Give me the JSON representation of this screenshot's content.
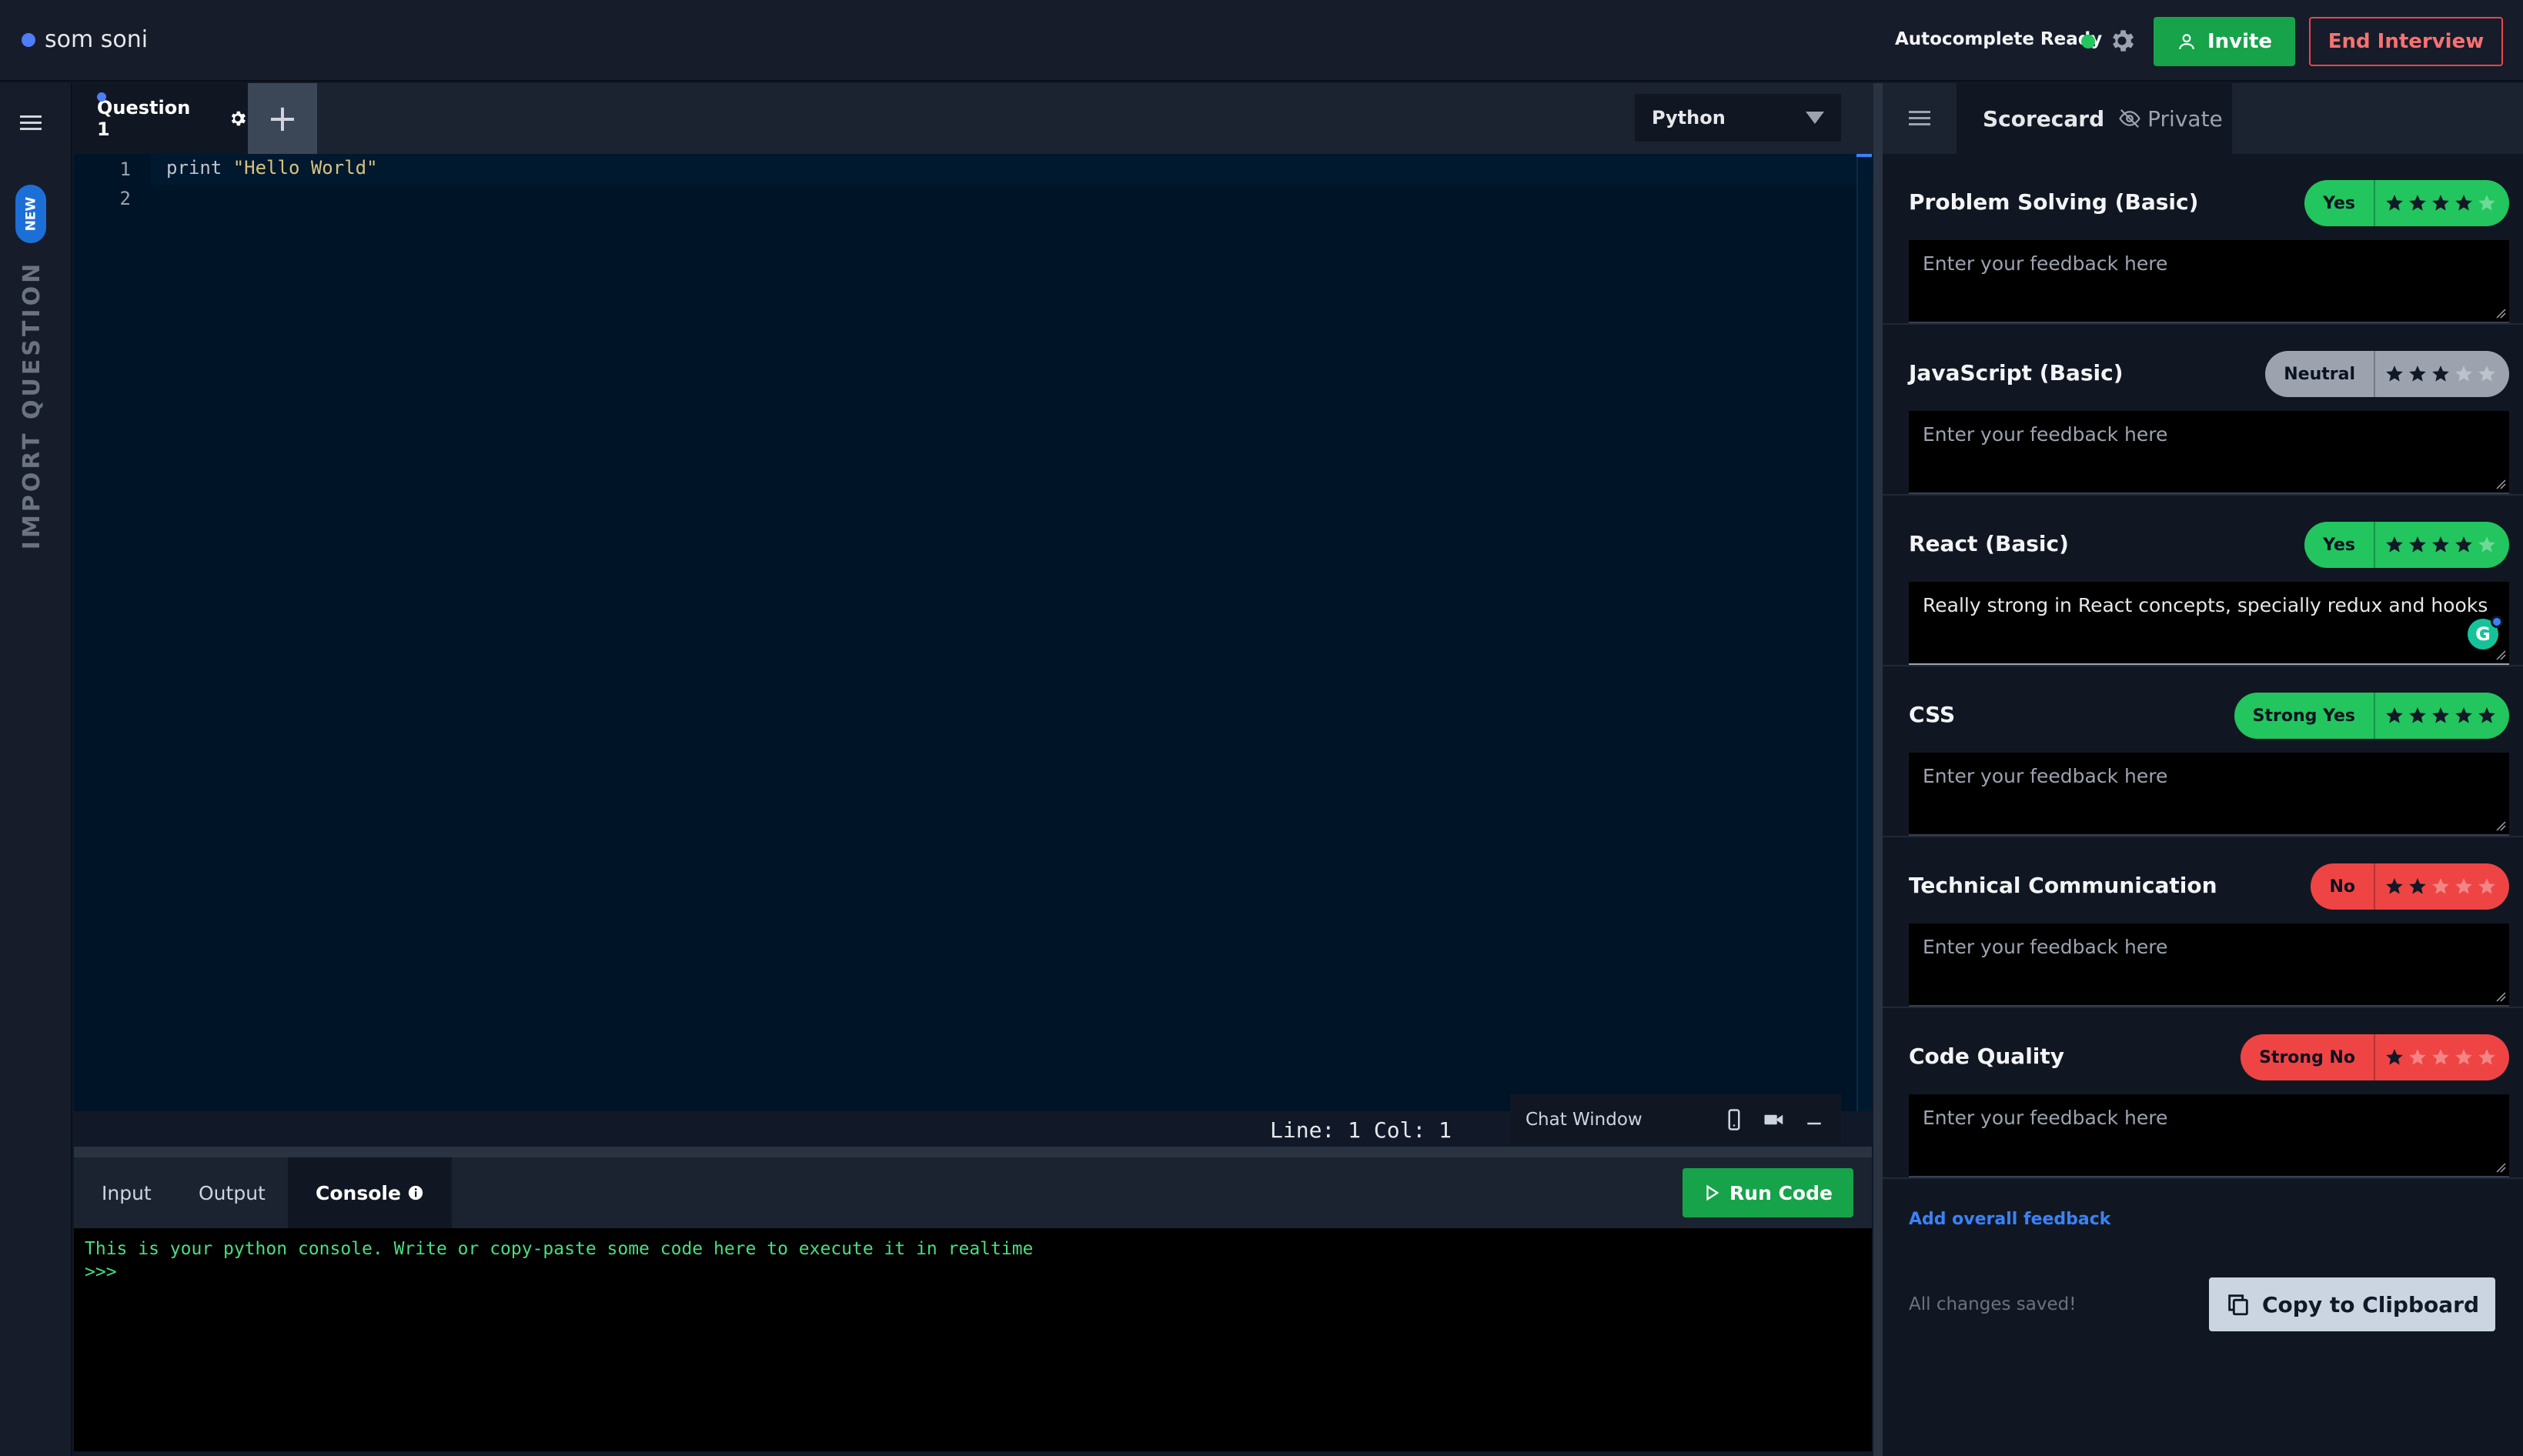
{
  "header": {
    "user_name": "som soni",
    "autocomplete_status": "Autocomplete Ready",
    "invite_label": "Invite",
    "end_interview_label": "End Interview"
  },
  "sidebar": {
    "new_badge": "NEW",
    "import_label": "IMPORT QUESTION"
  },
  "editor": {
    "tab_label": "Question 1",
    "add_tab_symbol": "+",
    "language": "Python",
    "line_numbers": [
      "1",
      "2"
    ],
    "code_keyword": "print",
    "code_string": "\"Hello World\"",
    "cursor_status": "Line: 1 Col: 1"
  },
  "chat": {
    "title": "Chat Window"
  },
  "bottom": {
    "tabs": [
      "Input",
      "Output",
      "Console"
    ],
    "active_tab": "Console",
    "run_label": "Run Code",
    "console_lines": [
      "This is your python console. Write or copy-paste some code here to execute it in realtime",
      ">>>"
    ]
  },
  "scorecard": {
    "title": "Scorecard",
    "private_label": "Private",
    "placeholder": "Enter your feedback here",
    "skills": [
      {
        "name": "Problem Solving (Basic)",
        "rating": "Yes",
        "stars": 4,
        "color": "#22c55e",
        "feedback": ""
      },
      {
        "name": "JavaScript (Basic)",
        "rating": "Neutral",
        "stars": 3,
        "color": "#9ca3af",
        "feedback": ""
      },
      {
        "name": "React (Basic)",
        "rating": "Yes",
        "stars": 4,
        "color": "#22c55e",
        "feedback": "Really strong in React concepts, specially redux and hooks"
      },
      {
        "name": "CSS",
        "rating": "Strong Yes",
        "stars": 5,
        "color": "#22c55e",
        "feedback": ""
      },
      {
        "name": "Technical Communication",
        "rating": "No",
        "stars": 2,
        "color": "#ef4444",
        "feedback": ""
      },
      {
        "name": "Code Quality",
        "rating": "Strong No",
        "stars": 1,
        "color": "#ef4444",
        "feedback": ""
      }
    ],
    "add_overall_label": "Add overall feedback",
    "save_status": "All changes saved!",
    "copy_label": "Copy to Clipboard"
  },
  "colors": {
    "accent_green": "#16a34a",
    "danger_red": "#ef4444",
    "link_blue": "#3b82f6",
    "editor_bg": "#001428"
  }
}
